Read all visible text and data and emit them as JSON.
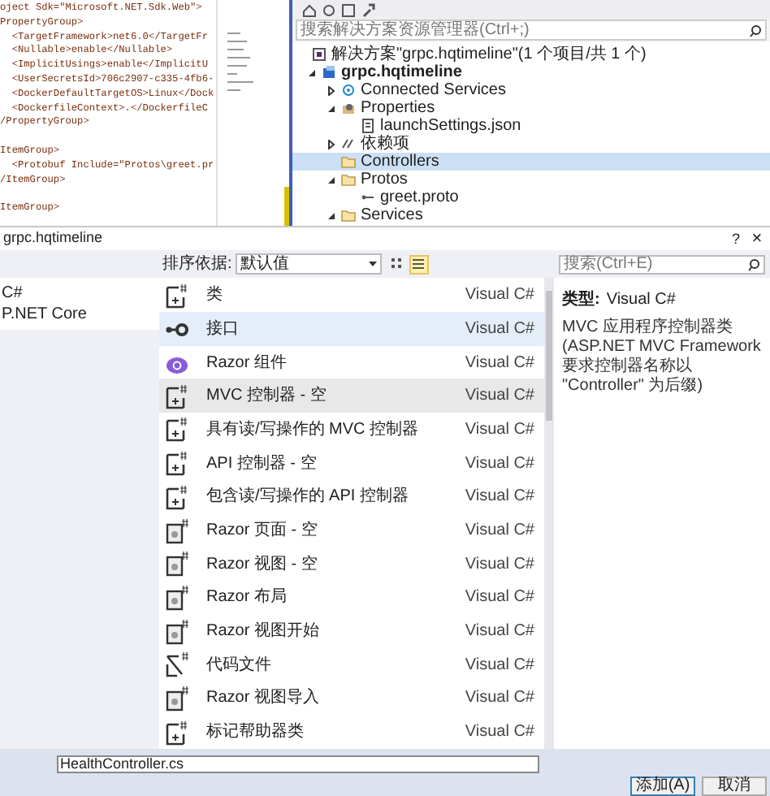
{
  "code_editor": {
    "blocks": [
      [
        "oject Sdk=\"Microsoft.NET.Sdk.Web\">",
        "PropertyGroup>",
        "  <TargetFramework>net6.0</TargetFr",
        "  <Nullable>enable</Nullable>",
        "  <ImplicitUsings>enable</ImplicitU",
        "  <UserSecretsId>706c2907-c335-4fb6-",
        "  <DockerDefaultTargetOS>Linux</Dock",
        "  <DockerfileContext>.</DockerfileC",
        "/PropertyGroup>"
      ],
      [
        "ItemGroup>",
        "  <Protobuf Include=\"Protos\\greet.pr",
        "/ItemGroup>"
      ],
      [
        "ItemGroup>"
      ]
    ]
  },
  "solution_explorer": {
    "search": {
      "placeholder": "搜索解决方案资源管理器(Ctrl+;)"
    },
    "tree": [
      {
        "label": "解决方案\"grpc.hqtimeline\"(1 个项目/共 1 个)",
        "kind": "solution",
        "selected": false,
        "children": [
          {
            "label": "grpc.hqtimeline",
            "kind": "project",
            "bold": true,
            "expanded": true,
            "selected": false,
            "children": [
              {
                "label": "Connected Services",
                "kind": "services",
                "expanded": false,
                "selected": false
              },
              {
                "label": "Properties",
                "kind": "properties",
                "expanded": true,
                "selected": false,
                "children": [
                  {
                    "label": "launchSettings.json",
                    "kind": "json",
                    "selected": false
                  }
                ]
              },
              {
                "label": "依赖项",
                "kind": "dependencies",
                "expanded": false,
                "selected": false
              },
              {
                "label": "Controllers",
                "kind": "folder",
                "selected": true
              },
              {
                "label": "Protos",
                "kind": "folder",
                "expanded": true,
                "selected": false,
                "children": [
                  {
                    "label": "greet.proto",
                    "kind": "proto",
                    "selected": false
                  }
                ]
              },
              {
                "label": "Services",
                "kind": "folder",
                "expanded": true,
                "selected": false
              }
            ]
          }
        ]
      }
    ]
  },
  "dialog": {
    "title": "grpc.hqtimeline",
    "help": "?",
    "close": "×",
    "sort_label": "排序依据:",
    "sort_value": "默认值",
    "view": {
      "grid_selected": false,
      "list_selected": true
    },
    "search": {
      "placeholder": "搜索(Ctrl+E)"
    },
    "categories": [
      {
        "label": "C#"
      },
      {
        "label": "P.NET Core"
      }
    ],
    "templates": [
      {
        "name": "类",
        "kind": "class",
        "lang": "Visual C#",
        "selected": false,
        "hovered": false
      },
      {
        "name": "接口",
        "kind": "interface",
        "lang": "Visual C#",
        "selected": false,
        "hovered": true
      },
      {
        "name": "Razor 组件",
        "kind": "component",
        "lang": "Visual C#",
        "selected": false,
        "hovered": false
      },
      {
        "name": "MVC 控制器 - 空",
        "kind": "class",
        "lang": "Visual C#",
        "selected": true,
        "hovered": false
      },
      {
        "name": "具有读/写操作的 MVC 控制器",
        "kind": "class",
        "lang": "Visual C#",
        "selected": false,
        "hovered": false
      },
      {
        "name": "API 控制器 - 空",
        "kind": "class",
        "lang": "Visual C#",
        "selected": false,
        "hovered": false
      },
      {
        "name": "包含读/写操作的 API 控制器",
        "kind": "class",
        "lang": "Visual C#",
        "selected": false,
        "hovered": false
      },
      {
        "name": "Razor 页面 - 空",
        "kind": "razor",
        "lang": "Visual C#",
        "selected": false,
        "hovered": false
      },
      {
        "name": "Razor 视图 - 空",
        "kind": "razor",
        "lang": "Visual C#",
        "selected": false,
        "hovered": false
      },
      {
        "name": "Razor 布局",
        "kind": "razor",
        "lang": "Visual C#",
        "selected": false,
        "hovered": false
      },
      {
        "name": "Razor 视图开始",
        "kind": "razor",
        "lang": "Visual C#",
        "selected": false,
        "hovered": false
      },
      {
        "name": "代码文件",
        "kind": "codefile",
        "lang": "Visual C#",
        "selected": false,
        "hovered": false
      },
      {
        "name": "Razor 视图导入",
        "kind": "razor",
        "lang": "Visual C#",
        "selected": false,
        "hovered": false
      },
      {
        "name": "标记帮助器类",
        "kind": "class",
        "lang": "Visual C#",
        "selected": false,
        "hovered": false
      }
    ],
    "details": {
      "type_label": "类型:",
      "type_value": "Visual C#",
      "description": "MVC 应用程序控制器类(ASP.NET MVC Framework 要求控制器名称以 \"Controller\" 为后缀)"
    },
    "name_field": {
      "value": "HealthController.cs"
    },
    "buttons": [
      {
        "label": "添加(A)",
        "primary": true
      },
      {
        "label": "取消",
        "primary": false
      }
    ]
  }
}
